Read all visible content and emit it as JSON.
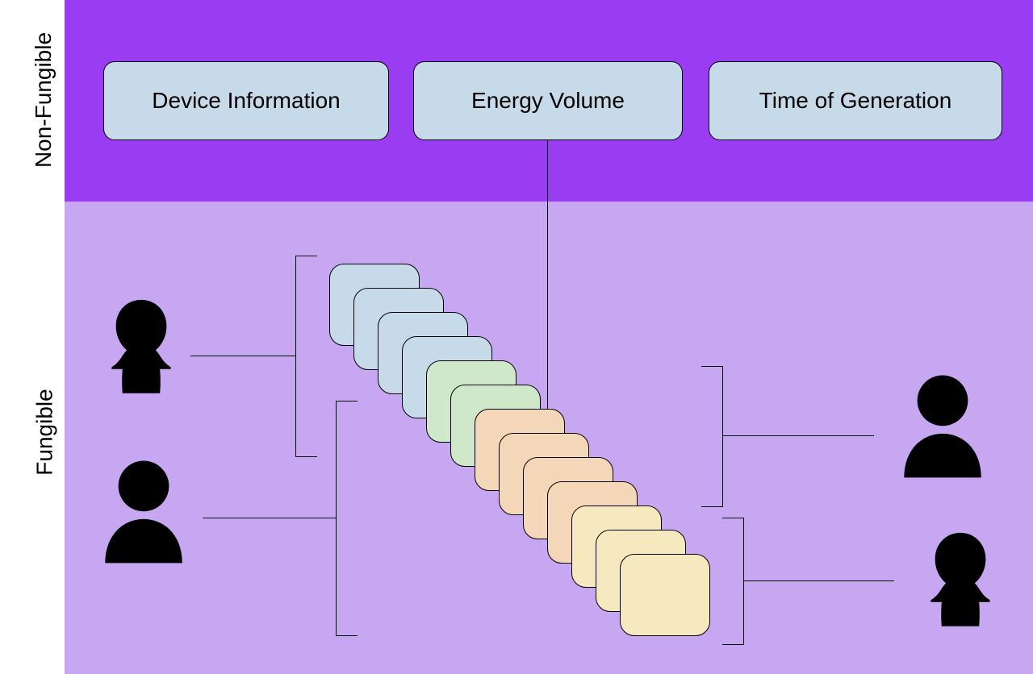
{
  "axis": {
    "top": "Non-Fungible",
    "bottom": "Fungible"
  },
  "boxes": {
    "device": "Device Information",
    "energy": "Energy Volume",
    "time": "Time of Generation"
  },
  "cards": {
    "colors": [
      "blue",
      "blue",
      "blue",
      "blue",
      "green",
      "green",
      "peach",
      "peach",
      "peach",
      "peach",
      "cream",
      "cream",
      "cream"
    ]
  },
  "people": {
    "topLeft": "person-female-icon",
    "botLeft": "person-male-icon",
    "topRight": "person-male-icon",
    "botRight": "person-female-icon"
  }
}
